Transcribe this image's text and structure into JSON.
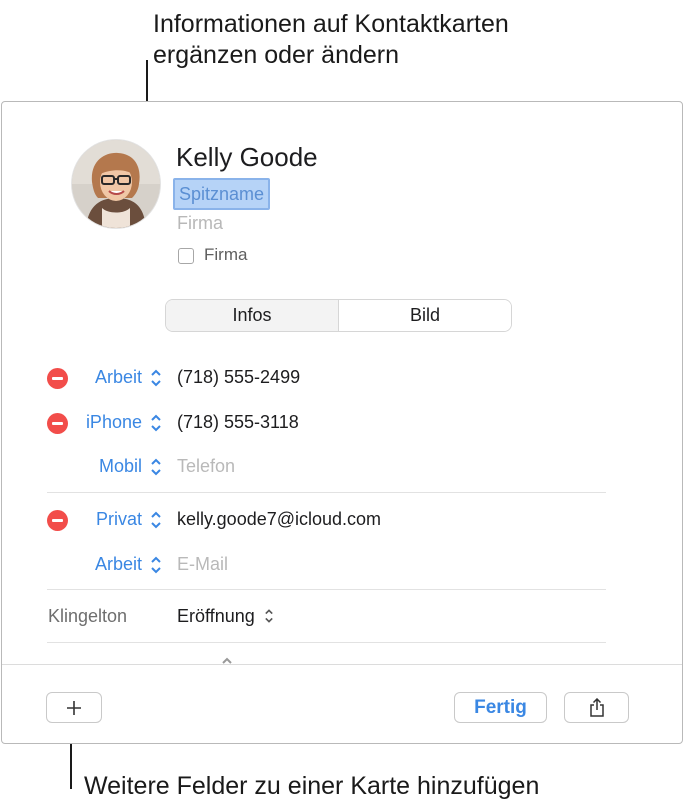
{
  "callouts": {
    "top_line1": "Informationen auf Kontaktkarten",
    "top_line2": "ergänzen oder ändern",
    "bottom": "Weitere Felder zu einer Karte hinzufügen"
  },
  "contact": {
    "name": "Kelly  Goode",
    "nickname_placeholder": "Spitzname",
    "company_placeholder": "Firma",
    "company_checkbox_label": "Firma",
    "company_checkbox_checked": false
  },
  "segmented": {
    "infos": "Infos",
    "bild": "Bild",
    "selected": "Bild"
  },
  "phones": [
    {
      "label": "Arbeit",
      "value": "(718) 555-2499",
      "removable": true
    },
    {
      "label": "iPhone",
      "value": "(718) 555-3118",
      "removable": true
    },
    {
      "label": "Mobil",
      "placeholder": "Telefon",
      "removable": false
    }
  ],
  "emails": [
    {
      "label": "Privat",
      "value": "kelly.goode7@icloud.com",
      "removable": true
    },
    {
      "label": "Arbeit",
      "placeholder": "E-Mail",
      "removable": false
    }
  ],
  "ringtone": {
    "label": "Klingelton",
    "value": "Eröffnung"
  },
  "buttons": {
    "add": "+",
    "done": "Fertig"
  },
  "icons": [
    "remove-field-icon",
    "popup-chevron-icon",
    "share-icon",
    "add-icon"
  ],
  "colors": {
    "accent": "#3a87e3",
    "remove": "#f24d4a",
    "selection": "#b6d3f7"
  }
}
